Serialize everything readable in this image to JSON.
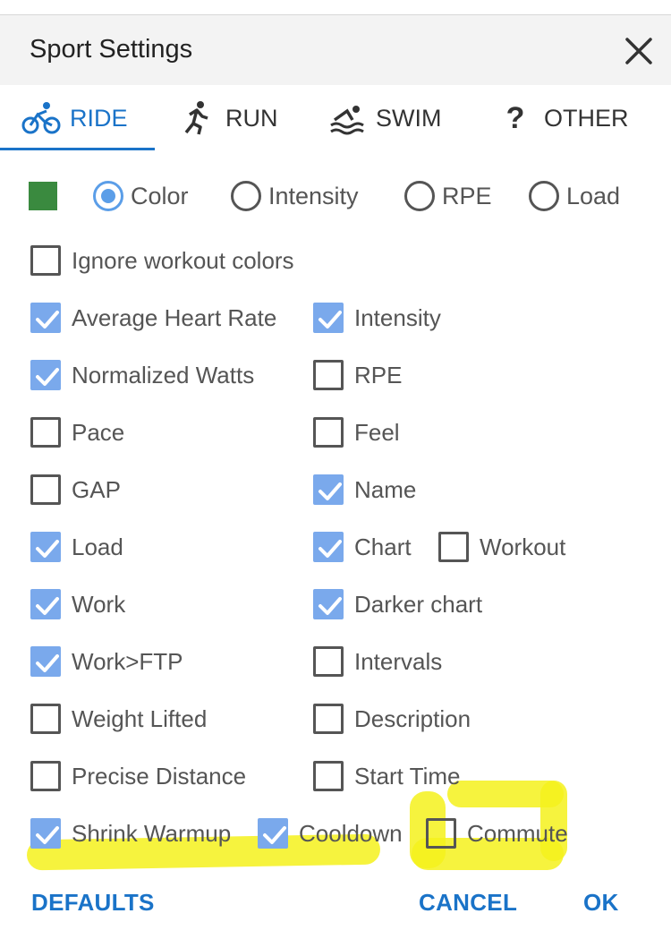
{
  "dialog": {
    "title": "Sport Settings",
    "close_icon": "close-icon"
  },
  "tabs": [
    {
      "label": "RIDE",
      "icon": "bike-icon",
      "active": true
    },
    {
      "label": "RUN",
      "icon": "run-icon",
      "active": false
    },
    {
      "label": "SWIM",
      "icon": "swim-icon",
      "active": false
    },
    {
      "label": "OTHER",
      "icon": "question-icon",
      "active": false
    }
  ],
  "color_swatch": "#3a8a3f",
  "color_mode": {
    "options": [
      "Color",
      "Intensity",
      "RPE",
      "Load"
    ],
    "selected": "Color"
  },
  "ignore_workout_colors": {
    "label": "Ignore workout colors",
    "checked": false
  },
  "fields_left": [
    {
      "label": "Average Heart Rate",
      "checked": true
    },
    {
      "label": "Normalized Watts",
      "checked": true
    },
    {
      "label": "Pace",
      "checked": false
    },
    {
      "label": "GAP",
      "checked": false
    },
    {
      "label": "Load",
      "checked": true
    },
    {
      "label": "Work",
      "checked": true
    },
    {
      "label": "Work>FTP",
      "checked": true
    },
    {
      "label": "Weight Lifted",
      "checked": false
    },
    {
      "label": "Precise Distance",
      "checked": false
    }
  ],
  "fields_right": [
    {
      "label": "Intensity",
      "checked": true
    },
    {
      "label": "RPE",
      "checked": false
    },
    {
      "label": "Feel",
      "checked": false
    },
    {
      "label": "Name",
      "checked": true
    },
    {
      "label": "Chart",
      "checked": true
    },
    {
      "label": "Darker chart",
      "checked": true
    },
    {
      "label": "Intervals",
      "checked": false
    },
    {
      "label": "Description",
      "checked": false
    },
    {
      "label": "Start Time",
      "checked": false
    }
  ],
  "chart_extra": {
    "label": "Workout",
    "checked": false
  },
  "last_row": [
    {
      "label": "Shrink Warmup",
      "checked": true
    },
    {
      "label": "Cooldown",
      "checked": true
    },
    {
      "label": "Commute",
      "checked": false
    }
  ],
  "footer": {
    "defaults": "DEFAULTS",
    "cancel": "CANCEL",
    "ok": "OK"
  },
  "colors": {
    "accent": "#1a73c8",
    "checkbox_on": "#7aa9ec",
    "highlight": "#f5f11c"
  }
}
